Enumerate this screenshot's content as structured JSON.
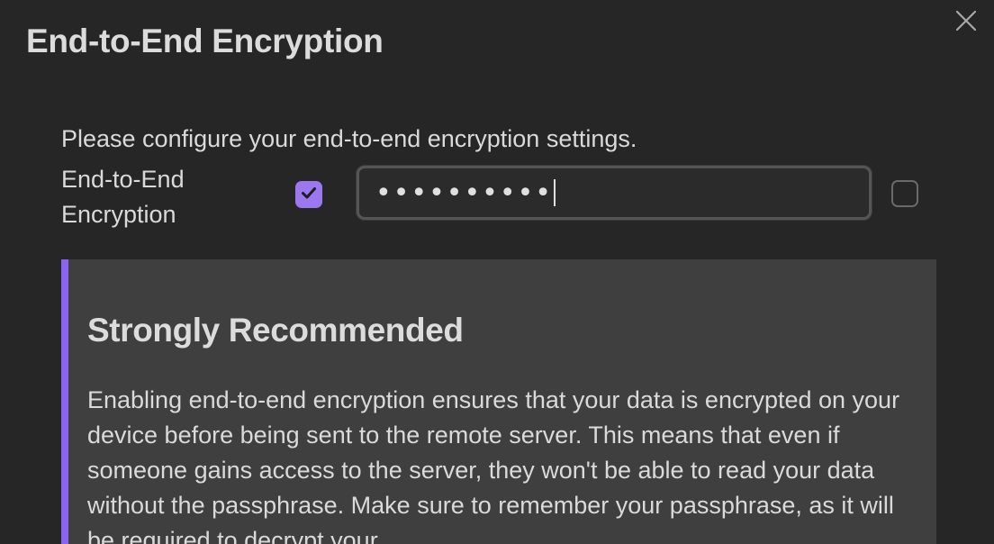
{
  "dialog": {
    "title": "End-to-End Encryption",
    "close_icon": "close-icon"
  },
  "settings": {
    "description": "Please configure your end-to-end encryption settings.",
    "e2ee_label": "End-to-End Encryption",
    "e2ee_enabled": true,
    "passphrase_value": "••••••••••",
    "show_passphrase_checked": false
  },
  "callout": {
    "title": "Strongly Recommended",
    "body": "Enabling end-to-end encryption ensures that your data is encrypted on your device before being sent to the remote server. This means that even if someone gains access to the server, they won't be able to read your data without the passphrase. Make sure to remember your passphrase, as it will be required to decrypt your"
  },
  "colors": {
    "accent": "#8c63f0",
    "checkbox_fill": "#9b77f0",
    "background": "#262626",
    "callout_background": "#3f3f3f"
  }
}
